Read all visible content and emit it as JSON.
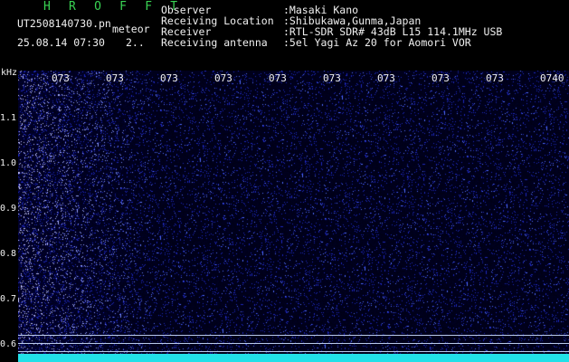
{
  "header": {
    "logo": "H R O F F T",
    "filename": "UT2508140730.pn",
    "meteor_label": "meteor",
    "datetime": "25.08.14 07:30",
    "count": "2..",
    "meta": [
      {
        "label": "Observer",
        "value": ":Masaki Kano"
      },
      {
        "label": "Receiving Location",
        "value": ":Shibukawa,Gunma,Japan"
      },
      {
        "label": "Receiver",
        "value": ":RTL-SDR SDR# 43dB L15 114.1MHz USB"
      },
      {
        "label": "Receiving antenna",
        "value": ":5el Yagi Az 20 for Aomori VOR"
      }
    ]
  },
  "axes": {
    "y_unit": "kHz",
    "y_ticks": [
      "1.1",
      "1.0",
      "0.9",
      "0.8",
      "0.7",
      "0.6"
    ],
    "x_ticks": [
      "073",
      "073",
      "073",
      "073",
      "073",
      "073",
      "073",
      "073",
      "073",
      "0740"
    ]
  },
  "colors": {
    "background": "#000000",
    "noise": "#1a1aa8",
    "signal_band": "#22e0e8",
    "logo": "#39d353"
  }
}
